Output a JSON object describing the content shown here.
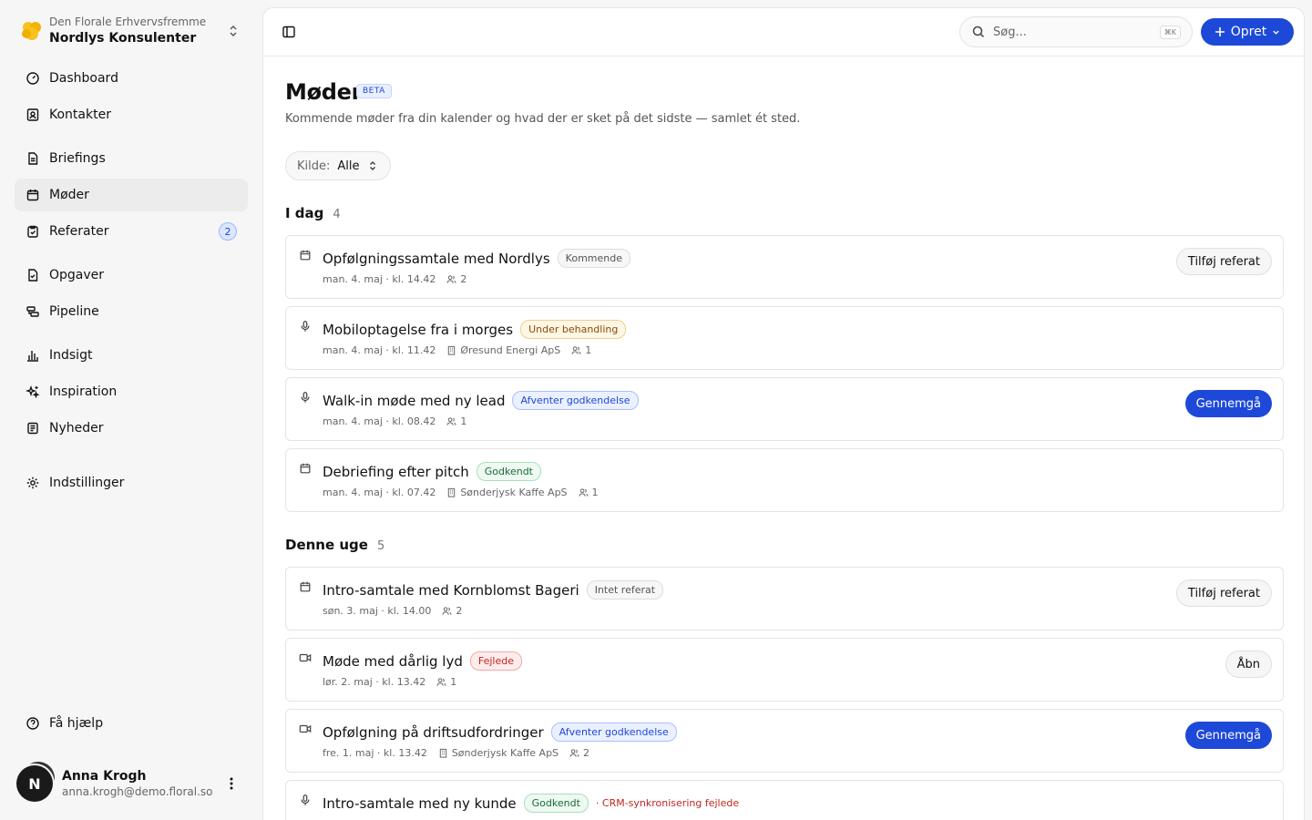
{
  "workspace": {
    "org": "Den Florale Erhvervsfremme",
    "name": "Nordlys Konsulenter"
  },
  "nav": {
    "dashboard": "Dashboard",
    "contacts": "Kontakter",
    "briefings": "Briefings",
    "meetings": "Møder",
    "minutes": "Referater",
    "minutes_count": "2",
    "tasks": "Opgaver",
    "pipeline": "Pipeline",
    "insight": "Indsigt",
    "inspiration": "Inspiration",
    "news": "Nyheder",
    "settings": "Indstillinger",
    "help": "Få hjælp"
  },
  "user": {
    "initial": "N",
    "name": "Anna Krogh",
    "email": "anna.krogh@demo.floral.so"
  },
  "topbar": {
    "search_placeholder": "Søg...",
    "shortcut": "⌘K",
    "create_label": "Opret"
  },
  "page": {
    "title": "Møder",
    "beta": "BETA",
    "subtitle": "Kommende møder fra din kalender og hvad der er sket på det sidste — samlet ét sted.",
    "filter_key": "Kilde:",
    "filter_value": "Alle"
  },
  "sections": {
    "today": {
      "label": "I dag",
      "count": "4"
    },
    "week": {
      "label": "Denne uge",
      "count": "5"
    }
  },
  "meetings": [
    {
      "title": "Opfølgningssamtale med Nordlys",
      "status": "Kommende",
      "date": "man. 4. maj · kl. 14.42",
      "company": "",
      "people": "2",
      "action": "Tilføj referat"
    },
    {
      "title": "Mobiloptagelse fra i morges",
      "status": "Under behandling",
      "date": "man. 4. maj · kl. 11.42",
      "company": "Øresund Energi ApS",
      "people": "1",
      "action": ""
    },
    {
      "title": "Walk-in møde med ny lead",
      "status": "Afventer godkendelse",
      "date": "man. 4. maj · kl. 08.42",
      "company": "",
      "people": "1",
      "action": "Gennemgå"
    },
    {
      "title": "Debriefing efter pitch",
      "status": "Godkendt",
      "date": "man. 4. maj · kl. 07.42",
      "company": "Sønderjysk Kaffe ApS",
      "people": "1",
      "action": ""
    },
    {
      "title": "Intro-samtale med Kornblomst Bageri",
      "status": "Intet referat",
      "date": "søn. 3. maj · kl. 14.00",
      "company": "",
      "people": "2",
      "action": "Tilføj referat"
    },
    {
      "title": "Møde med dårlig lyd",
      "status": "Fejlede",
      "date": "lør. 2. maj · kl. 13.42",
      "company": "",
      "people": "1",
      "action": "Åbn"
    },
    {
      "title": "Opfølgning på driftsudfordringer",
      "status": "Afventer godkendelse",
      "date": "fre. 1. maj · kl. 13.42",
      "company": "Sønderjysk Kaffe ApS",
      "people": "2",
      "action": "Gennemgå"
    },
    {
      "title": "Intro-samtale med ny kunde",
      "status": "Godkendt",
      "warning": "· CRM-synkronisering fejlede"
    }
  ],
  "colors": {
    "accent": "#1e49d8",
    "danger": "#c0261f",
    "success": "#1a6b3a",
    "warning": "#8a4b00"
  }
}
